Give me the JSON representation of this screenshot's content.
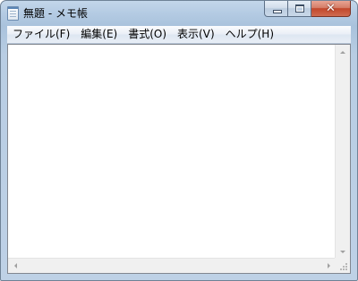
{
  "window": {
    "title": "無題 - メモ帳",
    "icon": "notepad-icon"
  },
  "caption": {
    "minimize_icon": "minimize-icon",
    "maximize_icon": "maximize-icon",
    "close_glyph": "✕"
  },
  "menu": {
    "items": [
      {
        "label": "ファイル(F)"
      },
      {
        "label": "編集(E)"
      },
      {
        "label": "書式(O)"
      },
      {
        "label": "表示(V)"
      },
      {
        "label": "ヘルプ(H)"
      }
    ]
  },
  "editor": {
    "content": ""
  },
  "colors": {
    "titlebar": "#b4cbe3",
    "close_button": "#c2472b",
    "scrollbar": "#f0f0f0"
  }
}
